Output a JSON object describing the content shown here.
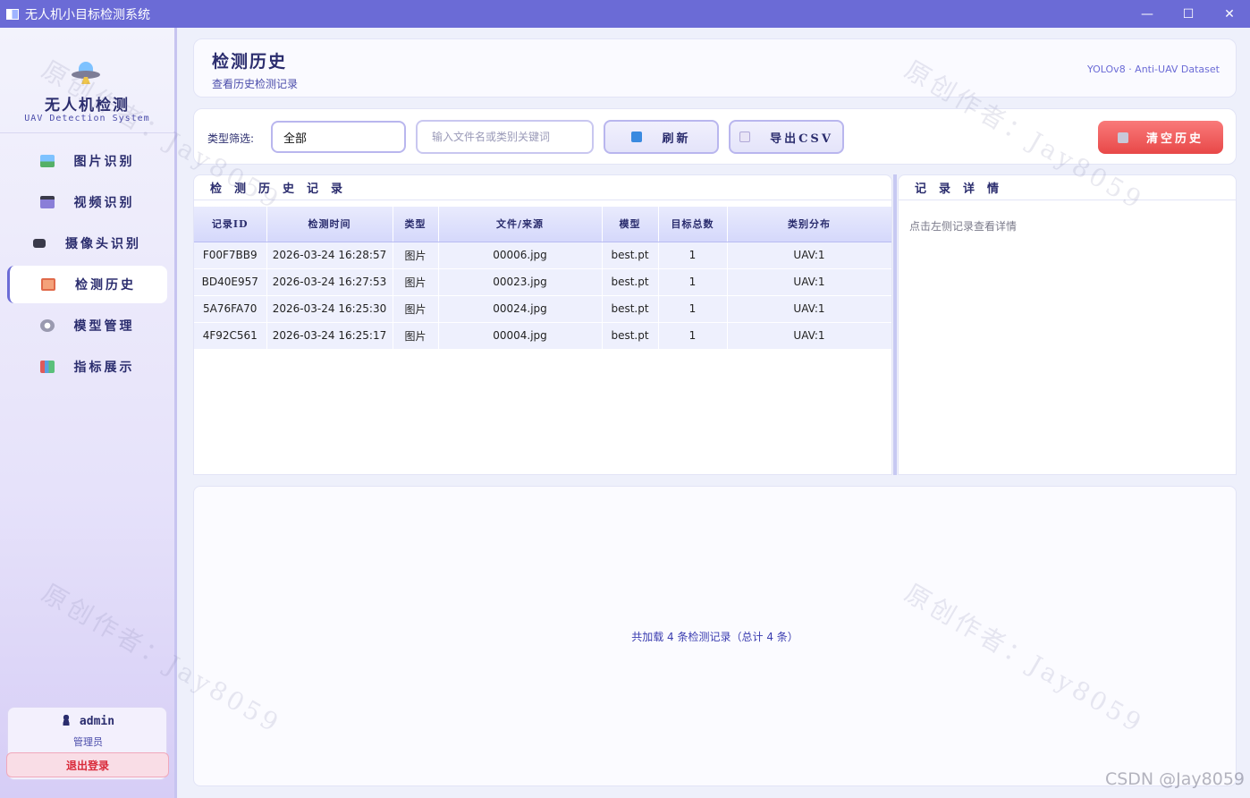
{
  "window": {
    "title": "无人机小目标检测系统",
    "minimize": "—",
    "maximize": "☐",
    "close": "✕"
  },
  "sidebar": {
    "logo_title": "无人机检测",
    "logo_subtitle": "UAV Detection System",
    "items": [
      {
        "label": "图片识别",
        "icon": "image-icon",
        "active": false
      },
      {
        "label": "视频识别",
        "icon": "video-icon",
        "active": false
      },
      {
        "label": "摄像头识别",
        "icon": "camera-icon",
        "active": false
      },
      {
        "label": "检测历史",
        "icon": "history-icon",
        "active": true
      },
      {
        "label": "模型管理",
        "icon": "gear-icon",
        "active": false
      },
      {
        "label": "指标展示",
        "icon": "chart-icon",
        "active": false
      }
    ],
    "user": {
      "name": "admin",
      "role": "管理员",
      "logout_label": "退出登录"
    }
  },
  "header": {
    "title": "检测历史",
    "subtitle": "查看历史检测记录",
    "dataset": "YOLOv8 · Anti-UAV Dataset"
  },
  "toolbar": {
    "filter_label": "类型筛选:",
    "filter_value": "全部",
    "search_placeholder": "输入文件名或类别关键词",
    "refresh_label": "刷新",
    "export_label": "导出CSV",
    "clear_label": "清空历史"
  },
  "history_table": {
    "title": "检测历史记录",
    "columns": [
      "记录ID",
      "检测时间",
      "类型",
      "文件/来源",
      "模型",
      "目标总数",
      "类别分布"
    ],
    "rows": [
      [
        "F00F7BB9",
        "2026-03-24 16:28:57",
        "图片",
        "00006.jpg",
        "best.pt",
        "1",
        "UAV:1"
      ],
      [
        "BD40E957",
        "2026-03-24 16:27:53",
        "图片",
        "00023.jpg",
        "best.pt",
        "1",
        "UAV:1"
      ],
      [
        "5A76FA70",
        "2026-03-24 16:25:30",
        "图片",
        "00024.jpg",
        "best.pt",
        "1",
        "UAV:1"
      ],
      [
        "4F92C561",
        "2026-03-24 16:25:17",
        "图片",
        "00004.jpg",
        "best.pt",
        "1",
        "UAV:1"
      ]
    ]
  },
  "detail": {
    "title": "记录详情",
    "hint": "点击左侧记录查看详情"
  },
  "summary": {
    "text": "共加载 4 条检测记录（总计 4 条）"
  },
  "watermark": {
    "text": "原创作者：Jay8059",
    "footer": "CSDN @Jay8059"
  },
  "colors": {
    "accent": "#6b6bd6",
    "danger": "#e84848",
    "text": "#2b2d6e"
  }
}
